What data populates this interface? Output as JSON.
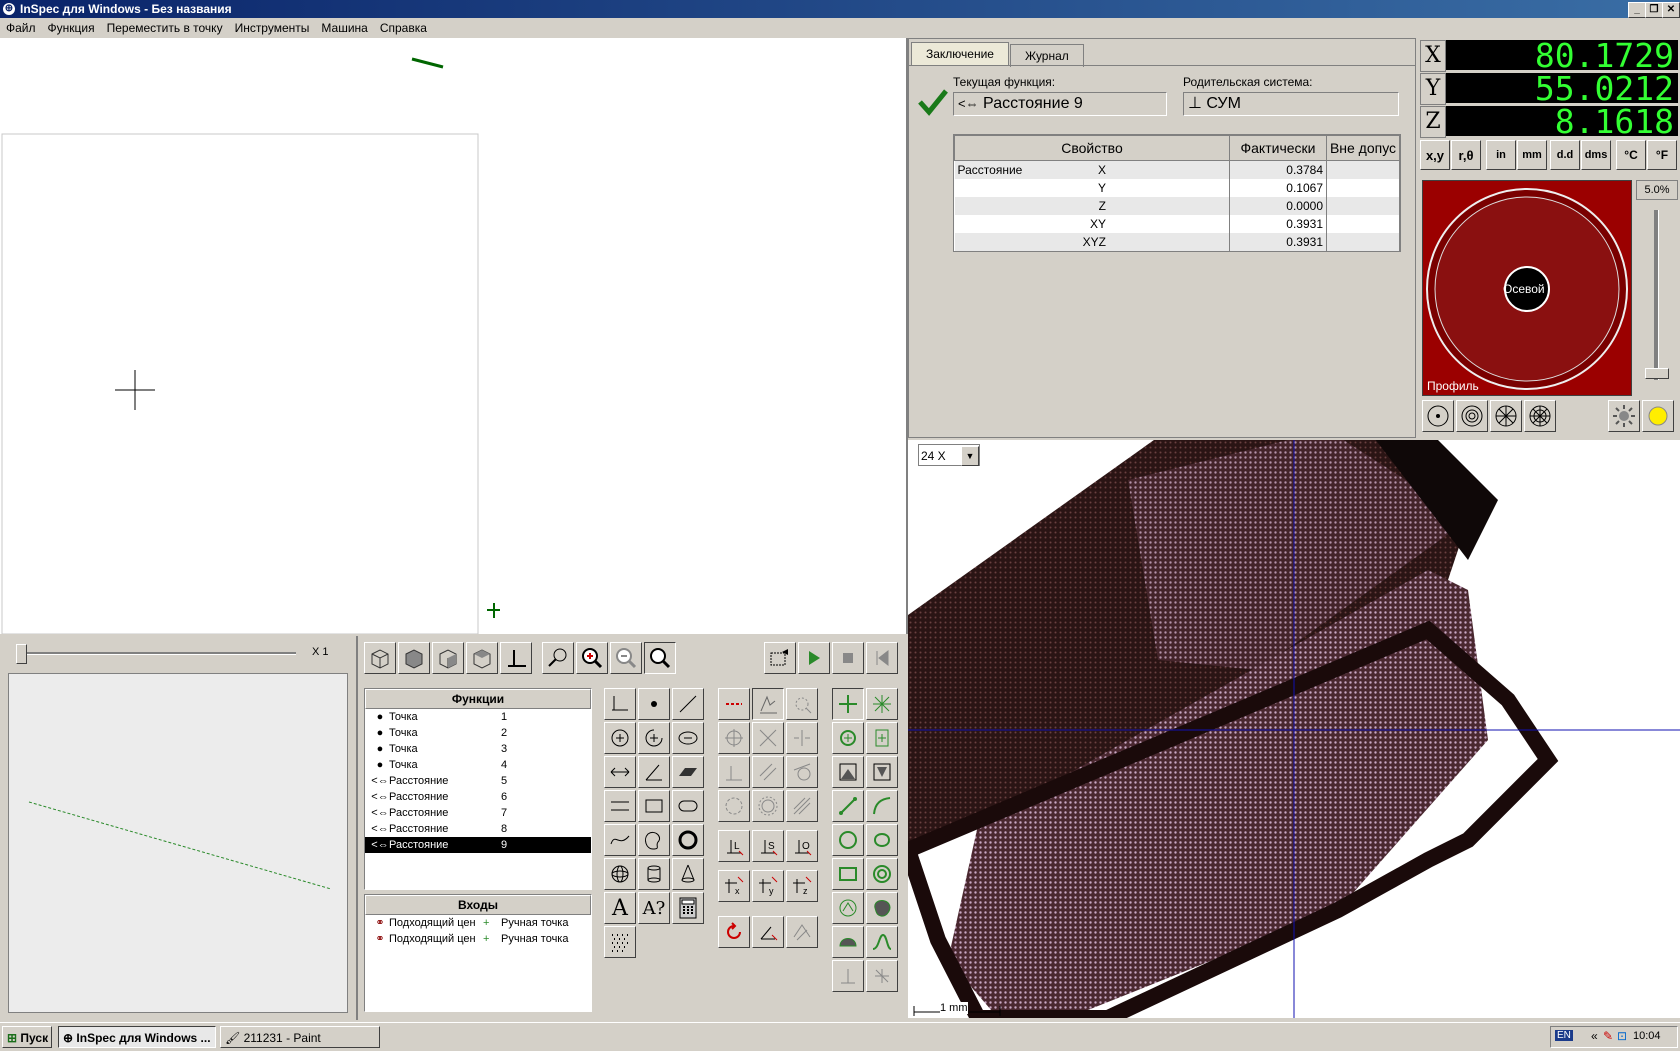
{
  "window": {
    "title": "InSpec для Windows - Без названия"
  },
  "menu": [
    "Файл",
    "Функция",
    "Переместить в точку",
    "Инструменты",
    "Машина",
    "Справка"
  ],
  "slider": {
    "zoom_label": "X 1"
  },
  "report": {
    "tabs": [
      "Заключение",
      "Журнал"
    ],
    "current_function_label": "Текущая функция:",
    "current_function_value": "Расстояние  9",
    "parent_system_label": "Родительская система:",
    "parent_system_value": "СУМ",
    "table_headers": [
      "Свойство",
      "Фактически",
      "Вне допус"
    ],
    "rows": [
      {
        "property": "Расстояние",
        "axis": "X",
        "actual": "0.3784",
        "out": ""
      },
      {
        "property": "",
        "axis": "Y",
        "actual": "0.1067",
        "out": ""
      },
      {
        "property": "",
        "axis": "Z",
        "actual": "0.0000",
        "out": ""
      },
      {
        "property": "",
        "axis": "XY",
        "actual": "0.3931",
        "out": ""
      },
      {
        "property": "",
        "axis": "XYZ",
        "actual": "0.3931",
        "out": ""
      }
    ]
  },
  "dro": [
    {
      "axis": "X",
      "value": "80.1729"
    },
    {
      "axis": "Y",
      "value": "55.0212"
    },
    {
      "axis": "Z",
      "value": "8.1618"
    }
  ],
  "units": {
    "cart": "x,y",
    "polar": "r,θ",
    "inch": "in",
    "mm": "mm",
    "dd": "d.d",
    "dms": "dms",
    "celsius": "°C",
    "fahrenheit": "°F"
  },
  "light": {
    "percent": "5.0%",
    "center_label": "Осевой",
    "mode_label": "Профиль"
  },
  "camera": {
    "zoom": "24 X",
    "scale": "1 mm"
  },
  "functions": {
    "header": "Функции",
    "items": [
      {
        "icon": "point",
        "name": "Точка",
        "num": "1"
      },
      {
        "icon": "point",
        "name": "Точка",
        "num": "2"
      },
      {
        "icon": "point",
        "name": "Точка",
        "num": "3"
      },
      {
        "icon": "point",
        "name": "Точка",
        "num": "4"
      },
      {
        "icon": "distance",
        "name": "Расстояние",
        "num": "5"
      },
      {
        "icon": "distance",
        "name": "Расстояние",
        "num": "6"
      },
      {
        "icon": "distance",
        "name": "Расстояние",
        "num": "7"
      },
      {
        "icon": "distance",
        "name": "Расстояние",
        "num": "8"
      },
      {
        "icon": "distance",
        "name": "Расстояние",
        "num": "9",
        "selected": true
      }
    ]
  },
  "inputs": {
    "header": "Входы",
    "items": [
      {
        "a": "Подходящий цен",
        "b": "Ручная точка"
      },
      {
        "a": "Подходящий цен",
        "b": "Ручная точка"
      }
    ]
  },
  "taskbar": {
    "start": "Пуск",
    "tasks": [
      "InSpec для Windows ...",
      "211231 - Paint"
    ],
    "lang": "EN",
    "clock": "10:04"
  },
  "colors": {
    "dro_green": "#33ff33",
    "title_blue": "#0a246a",
    "light_red": "#9b0000",
    "selection": "#000000"
  }
}
